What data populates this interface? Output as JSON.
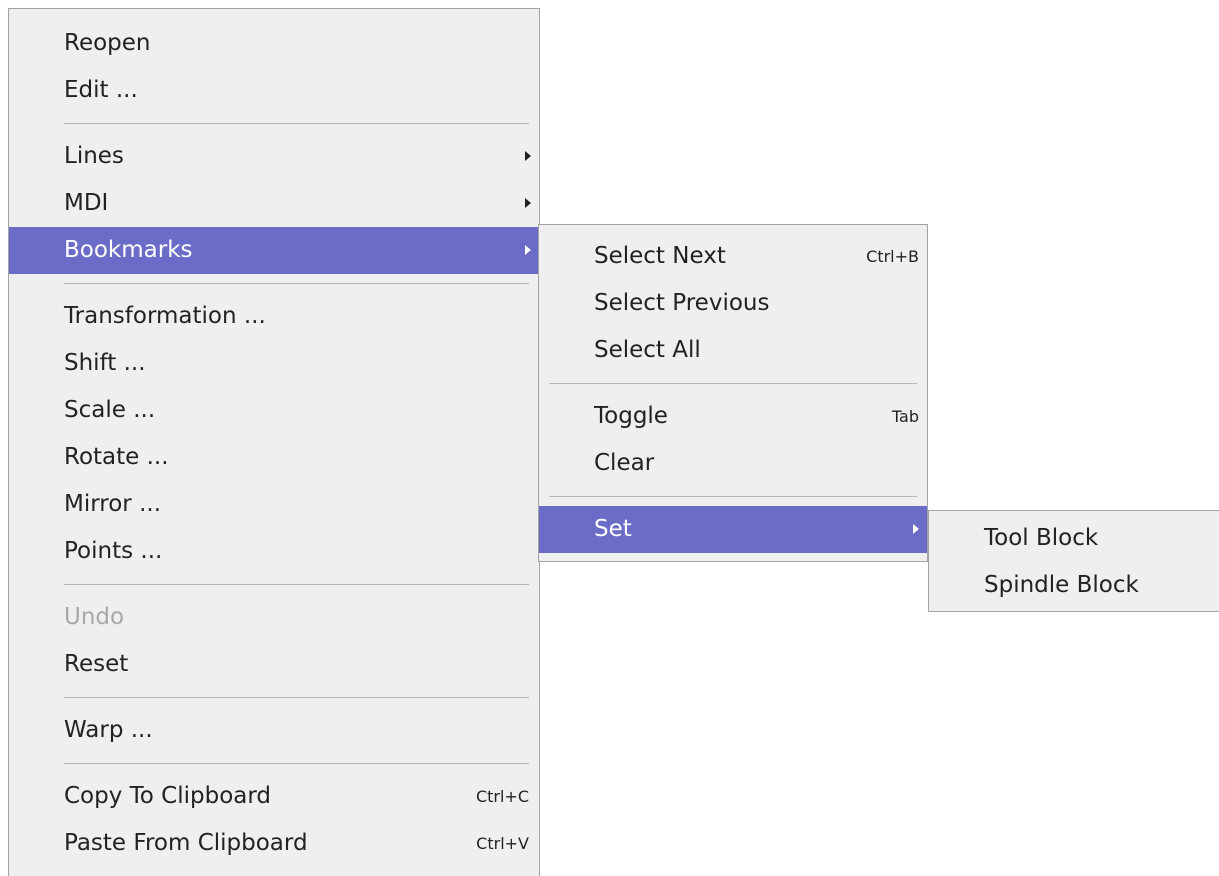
{
  "main_menu": {
    "items": [
      {
        "label": "Reopen"
      },
      {
        "label": "Edit ..."
      },
      {
        "label": "Lines"
      },
      {
        "label": "MDI"
      },
      {
        "label": "Bookmarks"
      },
      {
        "label": "Transformation ..."
      },
      {
        "label": "Shift ..."
      },
      {
        "label": "Scale ..."
      },
      {
        "label": "Rotate ..."
      },
      {
        "label": "Mirror ..."
      },
      {
        "label": "Points ..."
      },
      {
        "label": "Undo",
        "disabled": true
      },
      {
        "label": "Reset"
      },
      {
        "label": "Warp ..."
      },
      {
        "label": "Copy To Clipboard",
        "shortcut": "Ctrl+C"
      },
      {
        "label": "Paste From Clipboard",
        "shortcut": "Ctrl+V"
      }
    ]
  },
  "bookmarks_menu": {
    "items": [
      {
        "label": "Select Next",
        "shortcut": "Ctrl+B"
      },
      {
        "label": "Select Previous"
      },
      {
        "label": "Select All"
      },
      {
        "label": "Toggle",
        "shortcut": "Tab"
      },
      {
        "label": "Clear"
      },
      {
        "label": "Set"
      }
    ]
  },
  "set_menu": {
    "items": [
      {
        "label": "Tool Block"
      },
      {
        "label": "Spindle Block"
      }
    ]
  },
  "colors": {
    "highlight": "#6b6bc8",
    "menu_background": "#efefef",
    "disabled_text": "#a8a8a8"
  },
  "icons": {
    "submenu_arrow": "chevron-right-icon"
  }
}
